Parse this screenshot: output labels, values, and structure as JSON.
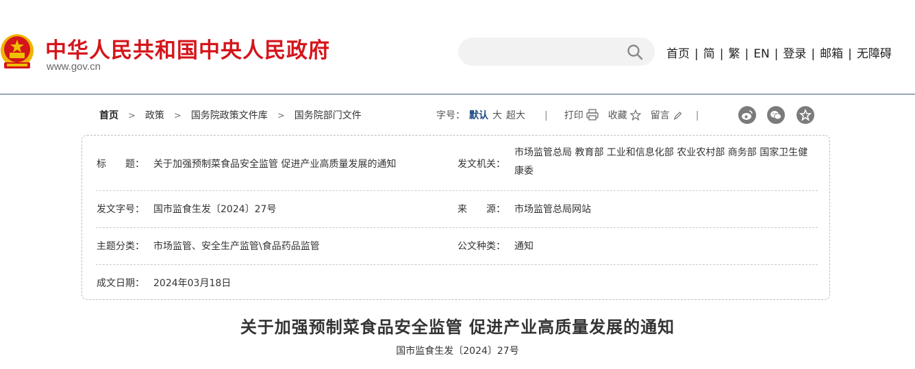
{
  "header": {
    "site_title": "中华人民共和国中央人民政府",
    "site_domain": "www.gov.cn",
    "search": {
      "placeholder": ""
    },
    "nav": [
      "首页",
      "简",
      "繁",
      "EN",
      "登录",
      "邮箱",
      "无障碍"
    ]
  },
  "breadcrumb": [
    "首页",
    "政策",
    "国务院政策文件库",
    "国务院部门文件"
  ],
  "toolbar": {
    "font_size_label": "字号：",
    "font_sizes": [
      "默认",
      "大",
      "超大"
    ],
    "print_label": "打印",
    "favorite_label": "收藏",
    "comment_label": "留言",
    "share_icons": [
      "weibo-icon",
      "wechat-icon",
      "star-icon"
    ]
  },
  "info": {
    "title_label": "标　　题：",
    "title_value": "关于加强预制菜食品安全监管 促进产业高质量发展的通知",
    "issuer_label": "发文机关：",
    "issuer_value": "市场监管总局 教育部 工业和信息化部 农业农村部 商务部 国家卫生健康委",
    "doc_no_label": "发文字号：",
    "doc_no_value": "国市监食生发〔2024〕27号",
    "source_label": "来　　源：",
    "source_value": "市场监管总局网站",
    "topic_label": "主题分类：",
    "topic_value": "市场监管、安全生产监管\\食品药品监管",
    "type_label": "公文种类：",
    "type_value": "通知",
    "date_label": "成文日期：",
    "date_value": "2024年03月18日"
  },
  "document": {
    "title": "关于加强预制菜食品安全监管 促进产业高质量发展的通知",
    "doc_no": "国市监食生发〔2024〕27号"
  },
  "colors": {
    "brand_red": "#d4151b",
    "active_blue": "#1e4a84",
    "icon_gray": "#7b7b7b"
  }
}
